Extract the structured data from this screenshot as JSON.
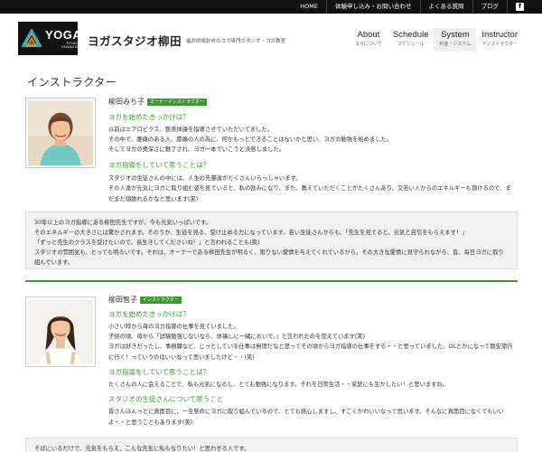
{
  "topbar": {
    "links": [
      "HOME",
      "体験申し込み・お問い合わせ",
      "よくある質問",
      "ブログ"
    ],
    "facebook_glyph": "f"
  },
  "header": {
    "logo_text": "YOGA",
    "logo_sub": "STUDIO YANAGIDA",
    "site_name": "ヨガスタジオ柳田",
    "tagline": "福井県坂井市のヨガ専門スタジオ・ヨガ教室"
  },
  "nav": [
    {
      "en": "About",
      "jp": "ヨガについて"
    },
    {
      "en": "Schedule",
      "jp": "スケジュール"
    },
    {
      "en": "System",
      "jp": "料金・システム"
    },
    {
      "en": "Instructor",
      "jp": "インストラクター"
    }
  ],
  "page": {
    "title": "インストラクター"
  },
  "instructors": [
    {
      "name": "柳田みち子",
      "badge": "オーナーインストラクター",
      "sections": [
        {
          "question": "ヨガを始めたきっかけは？",
          "lines": [
            "以前はエアロビクス、整美体操を指導させていただいてました。",
            "その中で、腰痛のある人、膝痛の人の為に、何かもっとできることはないかと思い、ヨガの勉強を始めました。",
            "そしてヨガの奥深さに魅了され、ヨガ一本でいこうと決意しました。"
          ]
        },
        {
          "question": "ヨガ指導をしていて思うことは？",
          "lines": [
            "スタジオの生徒さんの中には、人生の先輩達がたくさんいらっしゃいます。",
            "その人達が元気にヨガに取り組む姿を見ていると、私の励みになり、また、教えていただくことがたくさんあり、又若い人からのエネルギーも頂けるので、まだまだ頑張れるかなと思います(笑)"
          ]
        }
      ],
      "greybox": [
        "30年以上のヨガ指導にある柳田先生ですが、今も元気いっぱいです。",
        "そのエネルギーの大きさには驚かされます。そのうか、生徒を見る、受け止める力になっています。若い生徒さんからも、「先生を見てると、元気と自信をもらえます！」",
        "「ずっと先生のクラスを受けたいので、長生きしてくださいね！」と言われることも(笑)",
        "スタジオの雰囲気も、とっても明るいです。それは、オーナーである柳田先生が明るく、限りない愛情を与えてくれているから。その大きな愛情に見守られながら、皆、毎日ヨガに取り組んでいます。"
      ]
    },
    {
      "name": "柳田智子",
      "badge": "インストラクター",
      "sections": [
        {
          "question": "ヨガを始めたきっかけは？",
          "lines": [
            "小さい時から母のヨガ指導の仕事を見ていました。",
            "子供の頃、母から「試験勉強しないなら、体操しに一緒においで。」と言われたのを覚えています(笑)",
            "ヨガは好きだったし、事務職など、じっとしている仕事は無理だなと思ってその頃からヨガ指導の仕事をする・・と思っていました。OLとかになって散安旅行に行く！っていうのはいいなって思いましたけど・・(笑)"
          ]
        },
        {
          "question": "ヨガ指導をしていて思うことは？",
          "lines": [
            "たくさんの人に会えることで、私も元気になるし、とても勉強になります。それを日常生活・・家庭にも生かしたい！と思いますね。"
          ]
        },
        {
          "question": "スタジオの生徒さんについて思うこと",
          "lines": [
            "皆さんほんっとに真面目に、一生懸命にヨガに取り組んでいるので、とても感心しますし、すごくかわいいなって思います。そんなに真面目になくてもいいよ・・と思うこともあります(笑)"
          ]
        }
      ],
      "greybox": [
        "そばにいるだけで、元気をもらえ、こんな先生に私もなりたい！と思わせる人です。"
      ]
    }
  ],
  "colors": {
    "accent_green": "#3a9a2e",
    "topbar_bg": "#111111",
    "box_bg": "#f2f2f2"
  },
  "icons": {
    "facebook": "facebook-icon",
    "logo": "yoga-logo-mark"
  }
}
